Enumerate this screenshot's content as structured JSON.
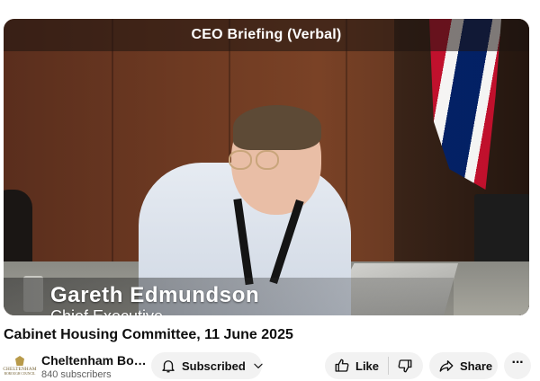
{
  "video": {
    "overlay_title": "CEO Briefing (Verbal)",
    "speaker_name": "Gareth Edmundson",
    "speaker_role": "Chief Executive"
  },
  "title": "Cabinet Housing Committee, 11 June 2025",
  "channel": {
    "name": "Cheltenham Bo…",
    "subscribers": "840 subscribers",
    "avatar_text": "CHELTENHAM",
    "avatar_subtext": "BOROUGH COUNCIL"
  },
  "actions": {
    "subscribe_label": "Subscribed",
    "like_label": "Like",
    "share_label": "Share",
    "more_label": "···"
  },
  "icons": {
    "subscribe": "bell-icon",
    "subscribe_menu": "chevron-down-icon",
    "like": "thumbs-up-icon",
    "dislike": "thumbs-down-icon",
    "share": "share-arrow-icon",
    "more": "more-horizontal-icon"
  }
}
